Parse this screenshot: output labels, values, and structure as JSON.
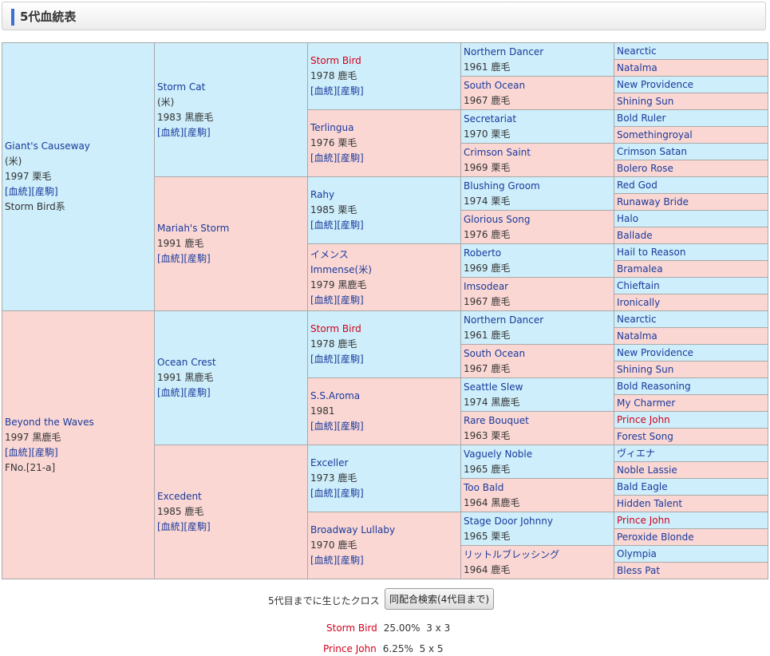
{
  "header": {
    "title": "5代血統表"
  },
  "link_labels": {
    "pedigree": "[血統]",
    "produce": "[産駒]"
  },
  "sire": {
    "name": "Giant's Causeway",
    "origin": "(米)",
    "birth": "1997 栗毛",
    "line": "Storm Bird系"
  },
  "dam": {
    "name": "Beyond the Waves",
    "birth": "1997 黒鹿毛",
    "family": "FNo.[21-a]"
  },
  "gen2": [
    {
      "name": "Storm Cat",
      "origin": "(米)",
      "birth": "1983 黒鹿毛"
    },
    {
      "name": "Mariah's Storm",
      "birth": "1991 鹿毛"
    },
    {
      "name": "Ocean Crest",
      "birth": "1991 黒鹿毛"
    },
    {
      "name": "Excedent",
      "birth": "1985 鹿毛"
    }
  ],
  "gen3": [
    {
      "name": "Storm Bird",
      "birth": "1978 鹿毛"
    },
    {
      "name": "Terlingua",
      "birth": "1976 栗毛"
    },
    {
      "name": "Rahy",
      "birth": "1985 栗毛"
    },
    {
      "name": "イメンス",
      "alt": "Immense(米)",
      "birth": "1979 黒鹿毛"
    },
    {
      "name": "Storm Bird",
      "birth": "1978 鹿毛"
    },
    {
      "name": "S.S.Aroma",
      "birth": "1981"
    },
    {
      "name": "Exceller",
      "birth": "1973 鹿毛"
    },
    {
      "name": "Broadway Lullaby",
      "birth": "1970 鹿毛"
    }
  ],
  "gen4": [
    {
      "name": "Northern Dancer",
      "birth": "1961 鹿毛"
    },
    {
      "name": "South Ocean",
      "birth": "1967 鹿毛"
    },
    {
      "name": "Secretariat",
      "birth": "1970 栗毛"
    },
    {
      "name": "Crimson Saint",
      "birth": "1969 栗毛"
    },
    {
      "name": "Blushing Groom",
      "birth": "1974 栗毛"
    },
    {
      "name": "Glorious Song",
      "birth": "1976 鹿毛"
    },
    {
      "name": "Roberto",
      "birth": "1969 鹿毛"
    },
    {
      "name": "Imsodear",
      "birth": "1967 鹿毛"
    },
    {
      "name": "Northern Dancer",
      "birth": "1961 鹿毛"
    },
    {
      "name": "South Ocean",
      "birth": "1967 鹿毛"
    },
    {
      "name": "Seattle Slew",
      "birth": "1974 黒鹿毛"
    },
    {
      "name": "Rare Bouquet",
      "birth": "1963 栗毛"
    },
    {
      "name": "Vaguely Noble",
      "birth": "1965 鹿毛"
    },
    {
      "name": "Too Bald",
      "birth": "1964 黒鹿毛"
    },
    {
      "name": "Stage Door Johnny",
      "birth": "1965 栗毛"
    },
    {
      "name": "リットルブレッシング",
      "birth": "1964 鹿毛"
    }
  ],
  "gen5": [
    "Nearctic",
    "Natalma",
    "New Providence",
    "Shining Sun",
    "Bold Ruler",
    "Somethingroyal",
    "Crimson Satan",
    "Bolero Rose",
    "Red God",
    "Runaway Bride",
    "Halo",
    "Ballade",
    "Hail to Reason",
    "Bramalea",
    "Chieftain",
    "Ironically",
    "Nearctic",
    "Natalma",
    "New Providence",
    "Shining Sun",
    "Bold Reasoning",
    "My Charmer",
    "Prince John",
    "Forest Song",
    "ヴィエナ",
    "Noble Lassie",
    "Bald Eagle",
    "Hidden Talent",
    "Prince John",
    "Peroxide Blonde",
    "Olympia",
    "Bless Pat"
  ],
  "cross_section": {
    "label": "5代目までに生じたクロス",
    "button": "同配合検索(4代目まで)"
  },
  "crosses": [
    {
      "name": "Storm Bird",
      "percent": "25.00%",
      "gens": "3 x 3"
    },
    {
      "name": "Prince John",
      "percent": "6.25%",
      "gens": "5 x 5"
    }
  ],
  "colors": {
    "sire_side": "#cdeefa",
    "dam_side": "#fad7d3",
    "inbred_name": "#d4001c",
    "link": "#1a3a9c",
    "accent": "#3b6fd6"
  }
}
